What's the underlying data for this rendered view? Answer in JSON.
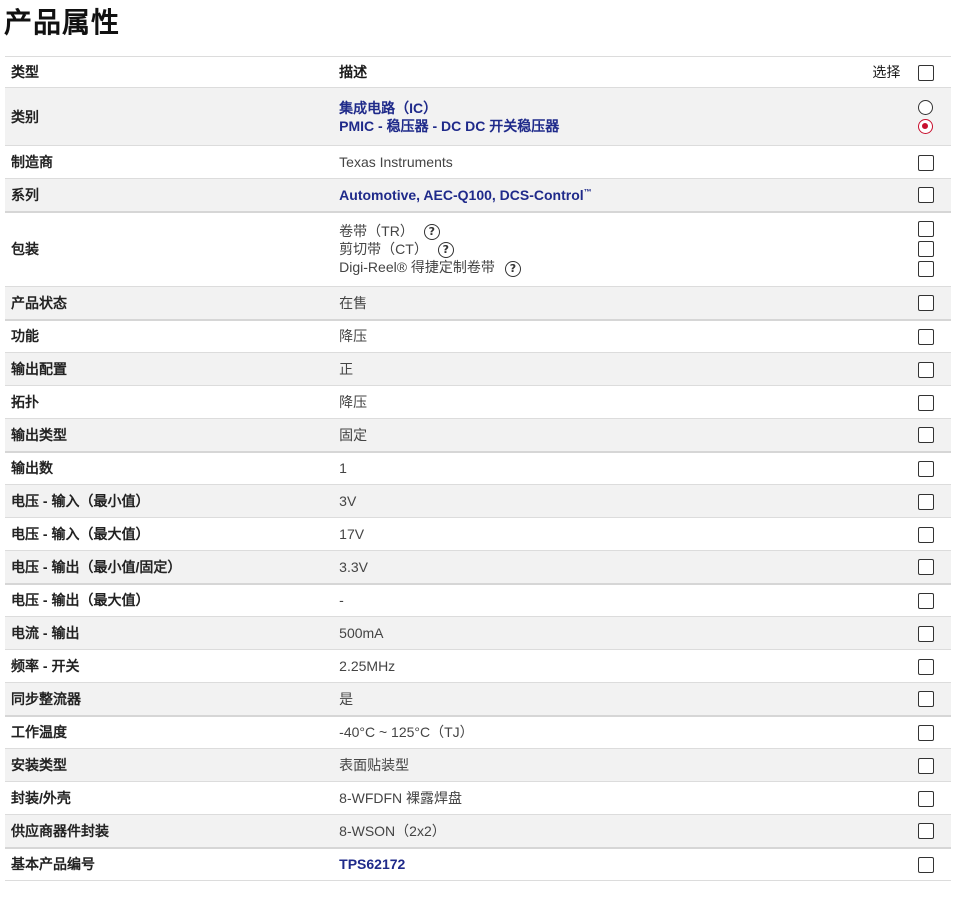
{
  "title": "产品属性",
  "header": {
    "type": "类型",
    "desc": "描述",
    "select": "选择"
  },
  "rows": [
    {
      "type": "类别",
      "desc": [
        "集成电路（IC）",
        "PMIC - 稳压器 - DC DC 开关稳压器"
      ]
    },
    {
      "type": "制造商",
      "desc": "Texas Instruments"
    },
    {
      "type": "系列",
      "desc": "Automotive, AEC-Q100, DCS-Control",
      "tm": "™"
    },
    {
      "type": "包装",
      "desc": [
        "卷带（TR）",
        "剪切带（CT）",
        "Digi-Reel® 得捷定制卷带"
      ]
    },
    {
      "type": "产品状态",
      "desc": "在售"
    },
    {
      "type": "功能",
      "desc": "降压"
    },
    {
      "type": "输出配置",
      "desc": "正"
    },
    {
      "type": "拓扑",
      "desc": "降压"
    },
    {
      "type": "输出类型",
      "desc": "固定"
    },
    {
      "type": "输出数",
      "desc": "1"
    },
    {
      "type": "电压 - 输入（最小值）",
      "desc": "3V"
    },
    {
      "type": "电压 - 输入（最大值）",
      "desc": "17V"
    },
    {
      "type": "电压 - 输出（最小值/固定）",
      "desc": "3.3V"
    },
    {
      "type": "电压 - 输出（最大值）",
      "desc": "-"
    },
    {
      "type": "电流 - 输出",
      "desc": "500mA"
    },
    {
      "type": "频率 - 开关",
      "desc": "2.25MHz"
    },
    {
      "type": "同步整流器",
      "desc": "是"
    },
    {
      "type": "工作温度",
      "desc": "-40°C ~ 125°C（TJ）"
    },
    {
      "type": "安装类型",
      "desc": "表面贴装型"
    },
    {
      "type": "封装/外壳",
      "desc": "8-WFDFN 裸露焊盘"
    },
    {
      "type": "供应商器件封装",
      "desc": "8-WSON（2x2）"
    },
    {
      "type": "基本产品编号",
      "desc": "TPS62172"
    }
  ],
  "icons": {
    "help": "help-circle-icon",
    "help_glyph": "?"
  },
  "colors": {
    "link": "#1f2a8a",
    "radio_selected": "#c8102e"
  }
}
